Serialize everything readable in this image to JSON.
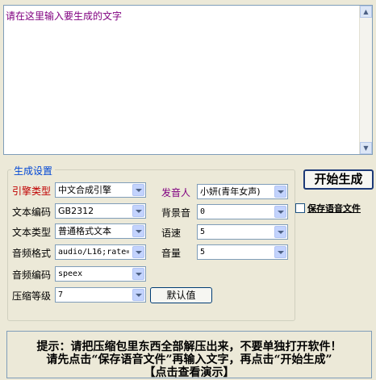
{
  "text_area": {
    "placeholder": "请在这里输入要生成的文字"
  },
  "group": {
    "title": "生成设置"
  },
  "engine": {
    "label": "引擎类型",
    "value": "中文合成引擎"
  },
  "encoding": {
    "label": "文本编码",
    "value": "GB2312"
  },
  "text_type": {
    "label": "文本类型",
    "value": "普通格式文本"
  },
  "audio_format": {
    "label": "音频格式",
    "value": "audio/L16;rate="
  },
  "audio_codec": {
    "label": "音频编码",
    "value": "speex"
  },
  "compression": {
    "label": "压缩等级",
    "value": "7"
  },
  "voice": {
    "label": "发音人",
    "value": "小妍(青年女声)"
  },
  "bg_sound": {
    "label": "背景音",
    "value": "0"
  },
  "speed": {
    "label": "语速",
    "value": "5"
  },
  "volume": {
    "label": "音量",
    "value": "5"
  },
  "default_button": "默认值",
  "start_button": "开始生成",
  "save_checkbox": {
    "label": "保存语音文件",
    "checked": false
  },
  "notice": {
    "line1": "提示：请把压缩包里东西全部解压出来，不要单独打开软件！",
    "line2": "请先点击“保存语音文件”再输入文字，再点击“开始生成”",
    "line3": "【点击查看演示】"
  }
}
